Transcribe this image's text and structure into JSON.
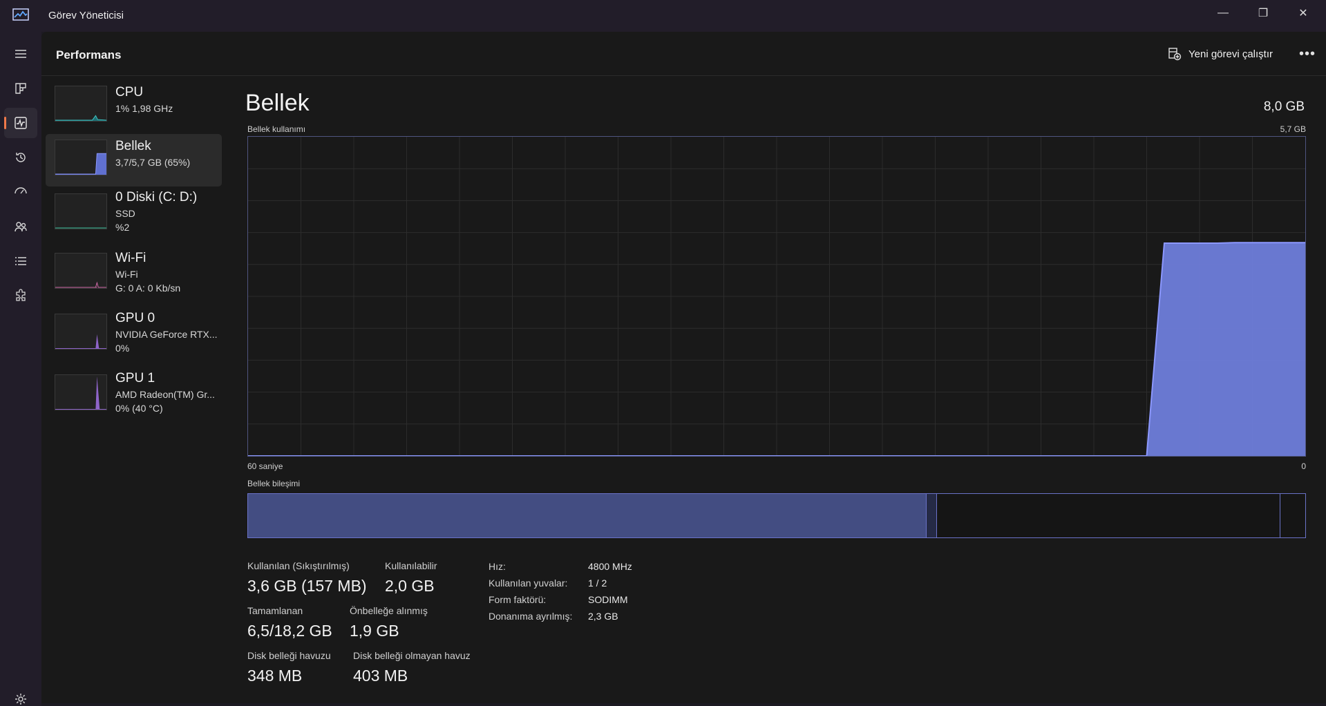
{
  "window": {
    "title": "Görev Yöneticisi",
    "minimize_label": "—",
    "restore_label": "❐",
    "close_label": "✕"
  },
  "header": {
    "page_title": "Performans",
    "run_task_label": "Yeni görevi çalıştır",
    "more_label": "•••"
  },
  "devices": [
    {
      "name": "CPU",
      "line1": "1%  1,98 GHz",
      "line2": ""
    },
    {
      "name": "Bellek",
      "line1": "3,7/5,7 GB (65%)",
      "line2": ""
    },
    {
      "name": "0 Diski (C: D:)",
      "line1": "SSD",
      "line2": "%2"
    },
    {
      "name": "Wi-Fi",
      "line1": "Wi-Fi",
      "line2": "G: 0 A: 0 Kb/sn"
    },
    {
      "name": "GPU 0",
      "line1": "NVIDIA GeForce RTX...",
      "line2": "0%"
    },
    {
      "name": "GPU 1",
      "line1": "AMD Radeon(TM) Gr...",
      "line2": "0%  (40 °C)"
    }
  ],
  "memory": {
    "title": "Bellek",
    "total": "8,0 GB",
    "usage_label": "Bellek kullanımı",
    "usage_max": "5,7 GB",
    "time_start": "60 saniye",
    "time_end": "0",
    "composition_label": "Bellek bileşimi",
    "composition": {
      "in_use_fraction": 0.642,
      "modified_fraction": 0.01,
      "standby_fraction": 0.325,
      "free_fraction": 0.023
    },
    "stats": {
      "in_use_label": "Kullanılan (Sıkıştırılmış)",
      "in_use_value": "3,6 GB (157 MB)",
      "available_label": "Kullanılabilir",
      "available_value": "2,0 GB",
      "committed_label": "Tamamlanan",
      "committed_value": "6,5/18,2 GB",
      "cached_label": "Önbelleğe alınmış",
      "cached_value": "1,9 GB",
      "paged_label": "Disk belleği havuzu",
      "paged_value": "348 MB",
      "nonpaged_label": "Disk belleği olmayan havuz",
      "nonpaged_value": "403 MB"
    },
    "details": [
      {
        "key": "Hız:",
        "value": "4800 MHz"
      },
      {
        "key": "Kullanılan yuvalar:",
        "value": "1 / 2"
      },
      {
        "key": "Form faktörü:",
        "value": "SODIMM"
      },
      {
        "key": "Donanıma ayrılmış:",
        "value": "2,3 GB"
      }
    ]
  },
  "chart_data": {
    "type": "area",
    "x": [
      60,
      9,
      8,
      5,
      4,
      3,
      0
    ],
    "values": [
      0,
      0,
      3.8,
      3.8,
      3.81,
      3.81,
      3.81
    ],
    "xlabel": "",
    "ylabel": "",
    "xlim": [
      60,
      0
    ],
    "ylim": [
      0,
      5.7
    ],
    "grid": true,
    "fill_color": "#7080e0"
  },
  "colors": {
    "accent": "#f0794a",
    "memory_fill": "#7080e0",
    "memory_line": "#8c98ff",
    "composition_used": "#434d82"
  }
}
